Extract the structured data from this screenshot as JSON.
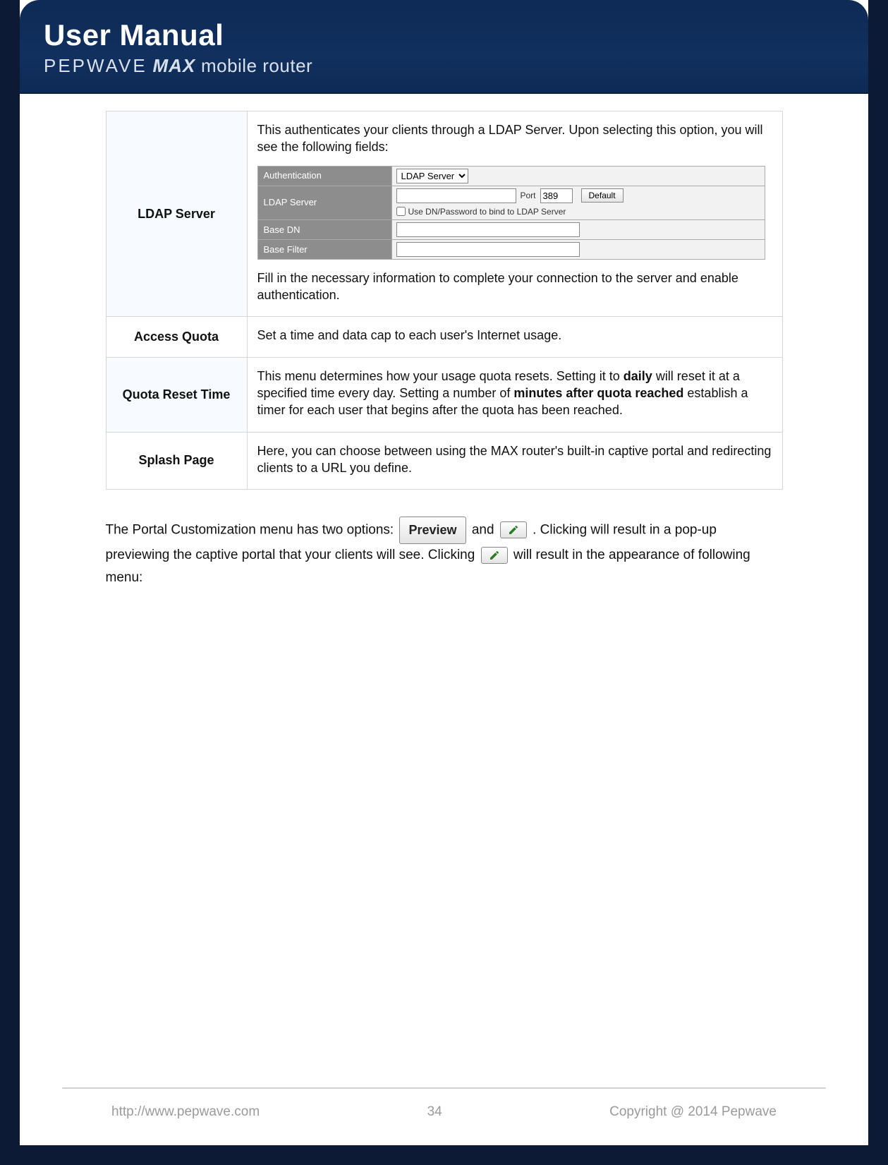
{
  "banner": {
    "title": "User Manual",
    "brand": "PEPWAVE",
    "product": "MAX",
    "tag": "mobile router"
  },
  "rows": {
    "ldap": {
      "label": "LDAP Server",
      "intro": "This authenticates your clients through a LDAP Server. Upon selecting this option, you will see the following fields:",
      "outro": "Fill in the necessary information to complete your connection to the server and enable authentication.",
      "mini": {
        "authentication": {
          "label": "Authentication",
          "selected": "LDAP Server"
        },
        "ldap_server": {
          "label": "LDAP Server",
          "port_label": "Port",
          "port_value": "389",
          "default_btn": "Default",
          "use_dn_label": "Use DN/Password to bind to LDAP Server"
        },
        "base_dn": {
          "label": "Base DN"
        },
        "base_filter": {
          "label": "Base Filter"
        }
      }
    },
    "access_quota": {
      "label": "Access Quota",
      "desc": "Set a time and data cap to each user's Internet usage."
    },
    "quota_reset": {
      "label": "Quota Reset Time",
      "p1a": "This menu determines how your usage quota resets. Setting it to ",
      "p1b": "daily",
      "p1c": " will reset it at a specified time every day. Setting a number of ",
      "p1d": "minutes after quota reached",
      "p1e": " establish a timer for each user that begins after the quota has been reached."
    },
    "splash": {
      "label": "Splash Page",
      "desc": "Here, you can choose between using the MAX router's built-in captive portal and redirecting clients to a URL you define."
    }
  },
  "below": {
    "t1": "The Portal Customization menu has two options: ",
    "preview_btn": "Preview",
    "t2": " and ",
    "t3": ". Clicking will result in a pop-up previewing the captive portal that your clients will see. Clicking ",
    "t4": " will result in the appearance of following menu:"
  },
  "footer": {
    "url": "http://www.pepwave.com",
    "page": "34",
    "copyright": "Copyright @ 2014 Pepwave"
  }
}
